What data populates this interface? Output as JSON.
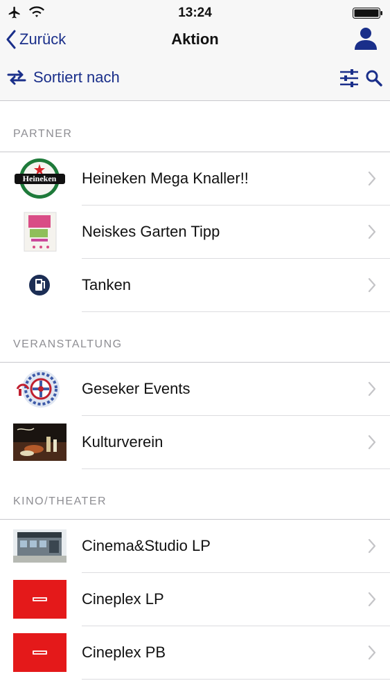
{
  "status": {
    "time": "13:24"
  },
  "nav": {
    "back_label": "Zurück",
    "title": "Aktion"
  },
  "toolbar": {
    "sort_label": "Sortiert nach"
  },
  "sections": [
    {
      "header": "PARTNER",
      "items": [
        {
          "label": "Heineken Mega Knaller!!"
        },
        {
          "label": "Neiskes Garten Tipp"
        },
        {
          "label": "Tanken"
        }
      ]
    },
    {
      "header": "VERANSTALTUNG",
      "items": [
        {
          "label": "Geseker Events"
        },
        {
          "label": "Kulturverein"
        }
      ]
    },
    {
      "header": "KINO/THEATER",
      "items": [
        {
          "label": "Cinema&Studio LP"
        },
        {
          "label": "Cineplex LP"
        },
        {
          "label": "Cineplex PB"
        }
      ]
    }
  ],
  "colors": {
    "accent": "#1a2f8a",
    "cineplex_red": "#e4191a",
    "heineken_green": "#1e7a3a"
  },
  "icons": [
    "airplane-icon",
    "wifi-icon",
    "battery-icon",
    "chevron-left-icon",
    "person-icon",
    "sort-arrows-icon",
    "filter-sliders-icon",
    "search-icon",
    "chevron-right-icon"
  ]
}
